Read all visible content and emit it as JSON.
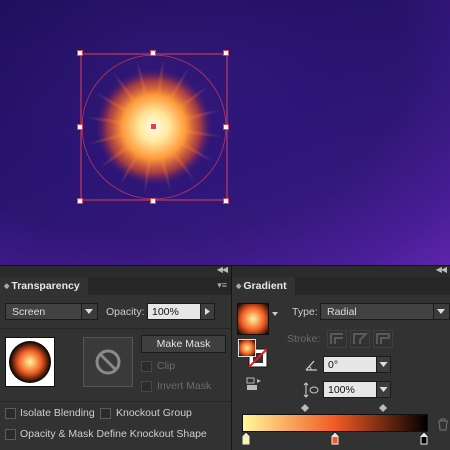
{
  "transparency": {
    "title": "Transparency",
    "blend_mode": "Screen",
    "opacity_label": "Opacity:",
    "opacity_value": "100%",
    "make_mask_label": "Make Mask",
    "clip_label": "Clip",
    "invert_mask_label": "Invert Mask",
    "isolate_label": "Isolate Blending",
    "knockout_label": "Knockout Group",
    "opacity_mask_label": "Opacity & Mask Define Knockout Shape"
  },
  "gradient": {
    "title": "Gradient",
    "type_label": "Type:",
    "type_value": "Radial",
    "stroke_label": "Stroke:",
    "angle_value": "0°",
    "aspect_value": "100%",
    "stops": [
      {
        "position": 0,
        "color": "#fff799"
      },
      {
        "position": 50,
        "color": "#f15a24"
      },
      {
        "position": 100,
        "color": "#000000"
      }
    ]
  },
  "colors": {
    "canvas_dark": "#2a1570",
    "canvas_light": "#5a24a8",
    "selection": "#e0405a",
    "panel_bg": "#323232"
  }
}
